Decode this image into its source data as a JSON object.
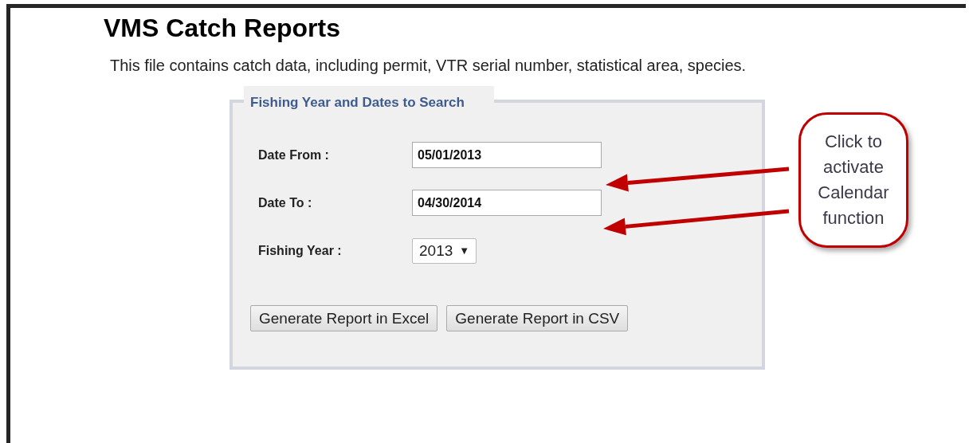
{
  "title": "VMS Catch Reports",
  "description": "This file contains catch data, including permit, VTR serial number, statistical area, species.",
  "search_panel": {
    "legend": "Fishing Year and Dates to Search",
    "fields": [
      {
        "kind": "date",
        "label": "Date From :",
        "value": "05/01/2013"
      },
      {
        "kind": "date",
        "label": "Date To :",
        "value": "04/30/2014"
      },
      {
        "kind": "select",
        "label": "Fishing Year :",
        "value": "2013",
        "caret": "▼"
      }
    ],
    "buttons": [
      "Generate Report in Excel",
      "Generate Report in CSV"
    ]
  },
  "callout": {
    "text": "Click to activate Calendar function"
  }
}
